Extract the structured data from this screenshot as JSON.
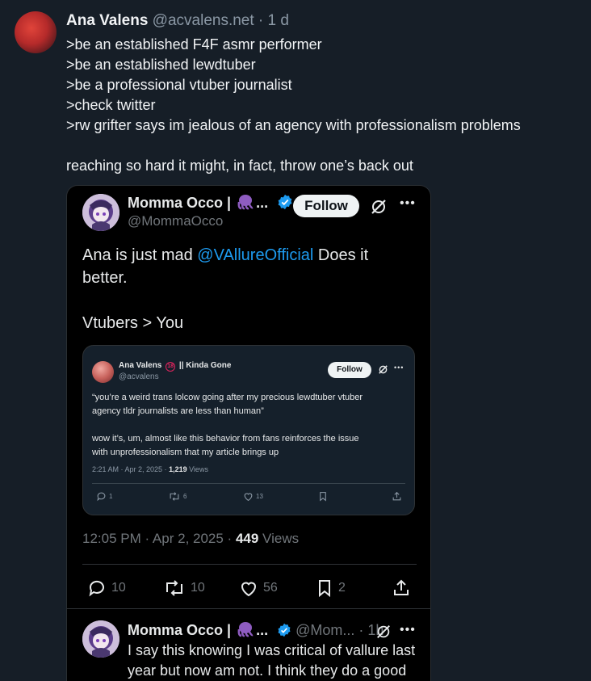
{
  "post": {
    "author_name": "Ana Valens",
    "author_handle": "@acvalens.net",
    "time_ago": "· 1 d",
    "lines": [
      ">be an established F4F asmr performer",
      ">be an established lewdtuber",
      ">be a professional vtuber journalist",
      ">check twitter",
      ">rw grifter says im jealous of an agency with professionalism problems"
    ],
    "closing_line": "reaching so hard it might, in fact, throw one’s back out"
  },
  "embed": {
    "name": "Momma Occo |",
    "name_suffix": "...",
    "handle": "@MommaOcco",
    "follow_label": "Follow",
    "body_prefix": "Ana is just mad ",
    "body_mention": "@VAllureOfficial",
    "body_suffix_1": " Does it",
    "body_suffix_2": "better.",
    "body_line_3": "Vtubers > You",
    "quote": {
      "name": "Ana Valens",
      "age_badge": "18",
      "name_suffix": "|| Kinda Gone",
      "handle": "@acvalens",
      "follow_label": "Follow",
      "lines": [
        "“you’re a weird trans lolcow going after my precious lewdtuber vtuber",
        "agency tldr journalists are less than human”",
        "",
        "wow it’s, um, almost like this behavior from fans reinforces the issue",
        "with unprofessionalism that my article brings up"
      ],
      "time": "2:21 AM · Apr 2, 2025 · ",
      "views_count": "1,219",
      "views_label": " Views",
      "replies": "1",
      "reposts": "6",
      "likes": "13"
    },
    "time": "12:05 PM · Apr 2, 2025 · ",
    "views_count": "449",
    "views_label": " Views",
    "replies": "10",
    "reposts": "10",
    "likes": "56",
    "bookmarks": "2",
    "reply": {
      "name": "Momma Occo |",
      "name_suffix": "...",
      "handle": "@Mom...",
      "time": " · 1h",
      "lines": [
        "I say this knowing I was critical of vallure last",
        "year but now am not. I think they do a good"
      ]
    }
  },
  "colors": {
    "background": "#161e27",
    "link": "#1d9bf0",
    "verified": "#1d9bf0",
    "age_badge": "#e0245e"
  },
  "icons": [
    "grok-icon",
    "more-icon",
    "verified-icon",
    "reply-icon",
    "repost-icon",
    "like-icon",
    "bookmark-icon",
    "share-icon"
  ]
}
